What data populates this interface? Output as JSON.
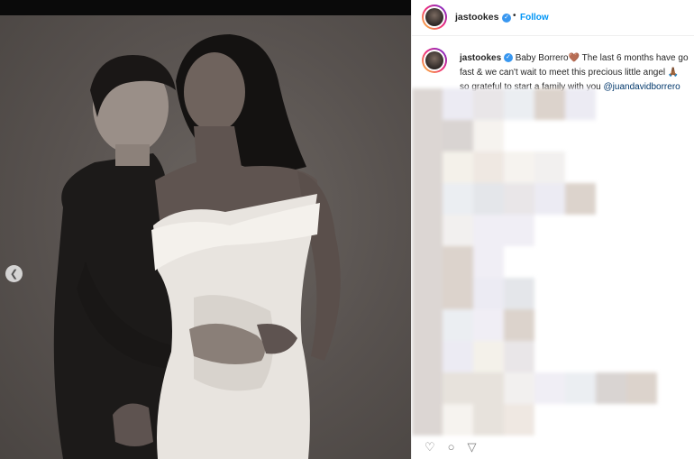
{
  "post": {
    "author": "jastookes",
    "follow_label": "Follow",
    "separator": "•",
    "caption_lines": [
      "Baby Borrero🤎 The last 6 months have go",
      "fast & we can't wait to meet this precious little angel 🙏🏾",
      "so grateful to start a family with you"
    ],
    "mention": "@juandavidborrero"
  },
  "icons": {
    "prev": "chevron-left-icon",
    "verified": "verified-badge-icon",
    "like": "heart-icon",
    "comment": "comment-icon",
    "share": "share-icon"
  },
  "colors": {
    "follow": "#0095f6",
    "verified": "#3897f0",
    "mention": "#00376b"
  }
}
